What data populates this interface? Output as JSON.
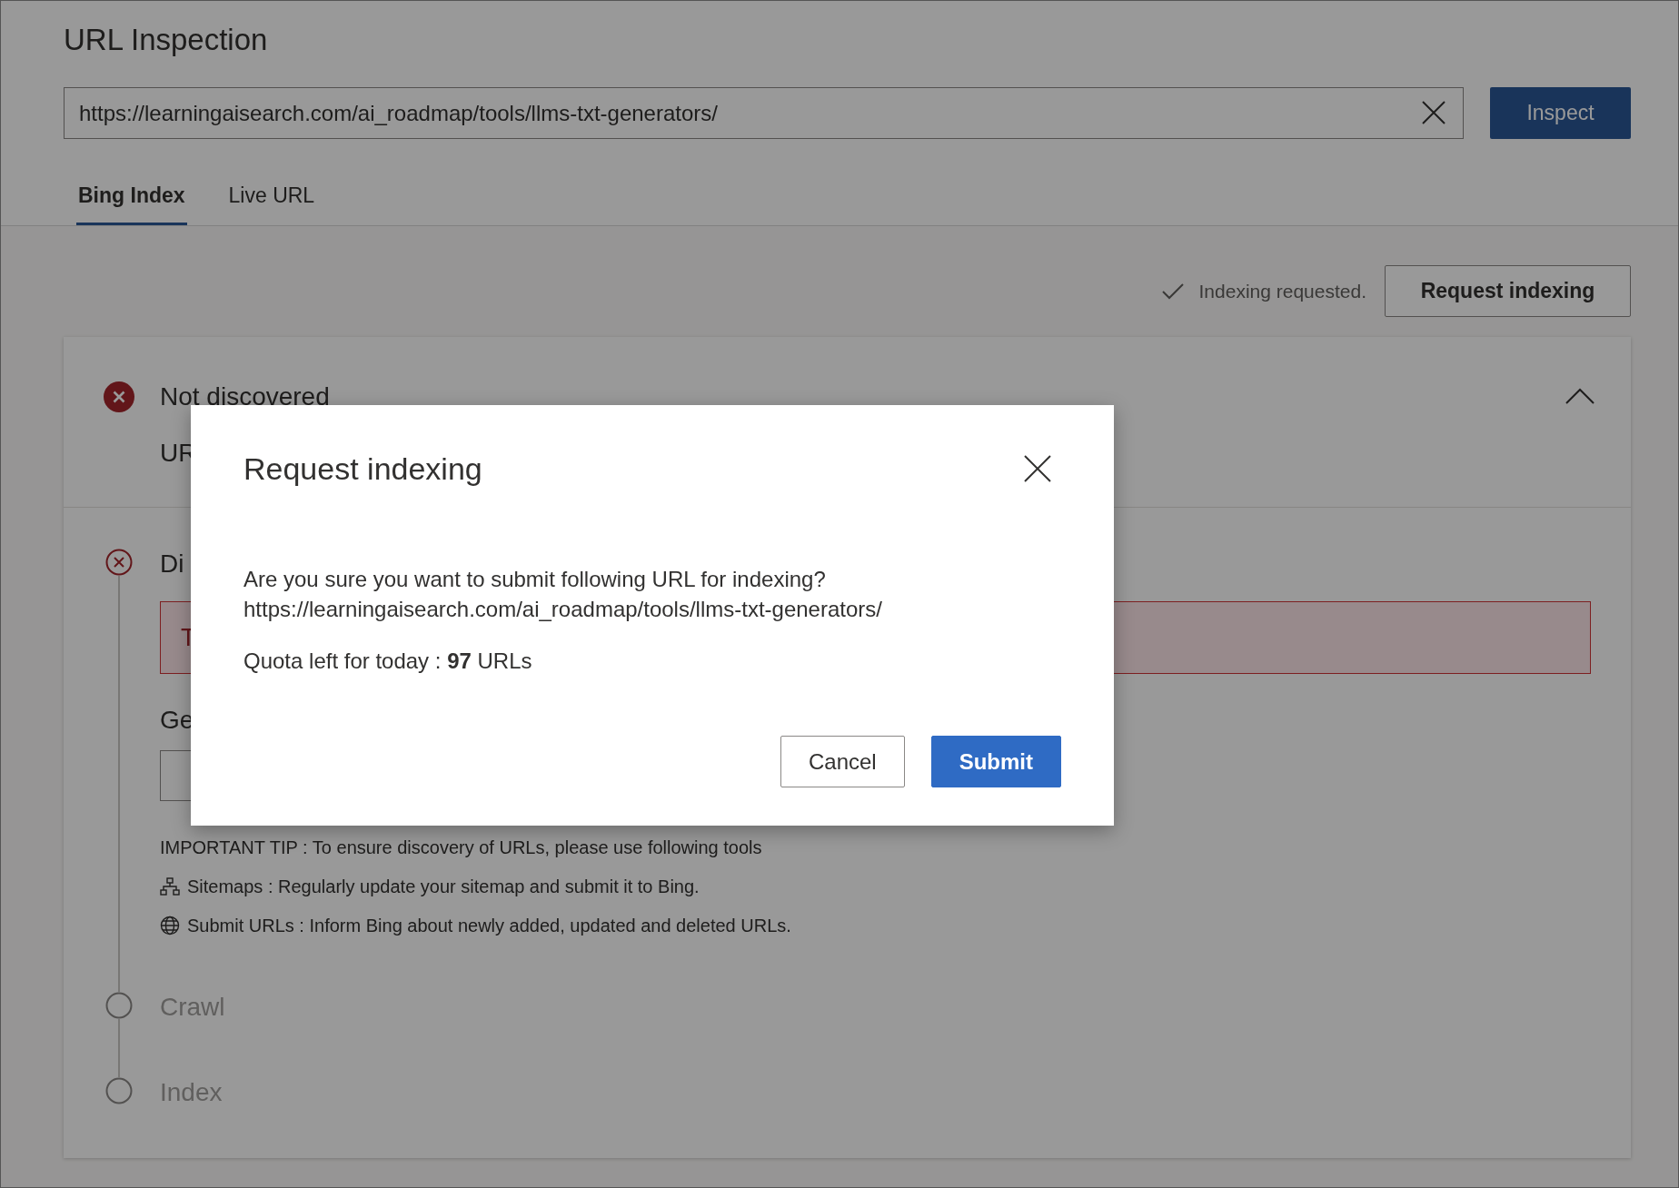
{
  "page": {
    "title": "URL Inspection"
  },
  "url_field": {
    "value": "https://learningaisearch.com/ai_roadmap/tools/llms-txt-generators/"
  },
  "inspect_button": "Inspect",
  "tabs": [
    {
      "label": "Bing Index",
      "selected": true
    },
    {
      "label": "Live URL",
      "selected": false
    }
  ],
  "status": {
    "text": "Indexing requested."
  },
  "request_button": "Request indexing",
  "summary": {
    "status": "Not discovered",
    "detail": "UR",
    "expanded": true
  },
  "steps": [
    {
      "kind": "error",
      "label": "Di",
      "alert": "T",
      "heading": "Ge"
    },
    {
      "kind": "pending",
      "label": "Crawl"
    },
    {
      "kind": "pending",
      "label": "Index"
    }
  ],
  "tips": {
    "heading": "IMPORTANT TIP : To ensure discovery of URLs, please use following tools",
    "items": [
      {
        "kind": "sitemap",
        "text": "Sitemaps : Regularly update your sitemap and submit it to Bing."
      },
      {
        "kind": "globe",
        "text": "Submit URLs : Inform Bing about newly added, updated and deleted URLs."
      }
    ]
  },
  "dialog": {
    "title": "Request indexing",
    "message": "Are you sure you want to submit following URL for indexing?",
    "url": "https://learningaisearch.com/ai_roadmap/tools/llms-txt-generators/",
    "quota": "Quota left for today : **97** URLs",
    "buttons": [
      {
        "label": "Cancel",
        "kind": "secondary"
      },
      {
        "label": "Submit",
        "kind": "primary"
      }
    ]
  }
}
